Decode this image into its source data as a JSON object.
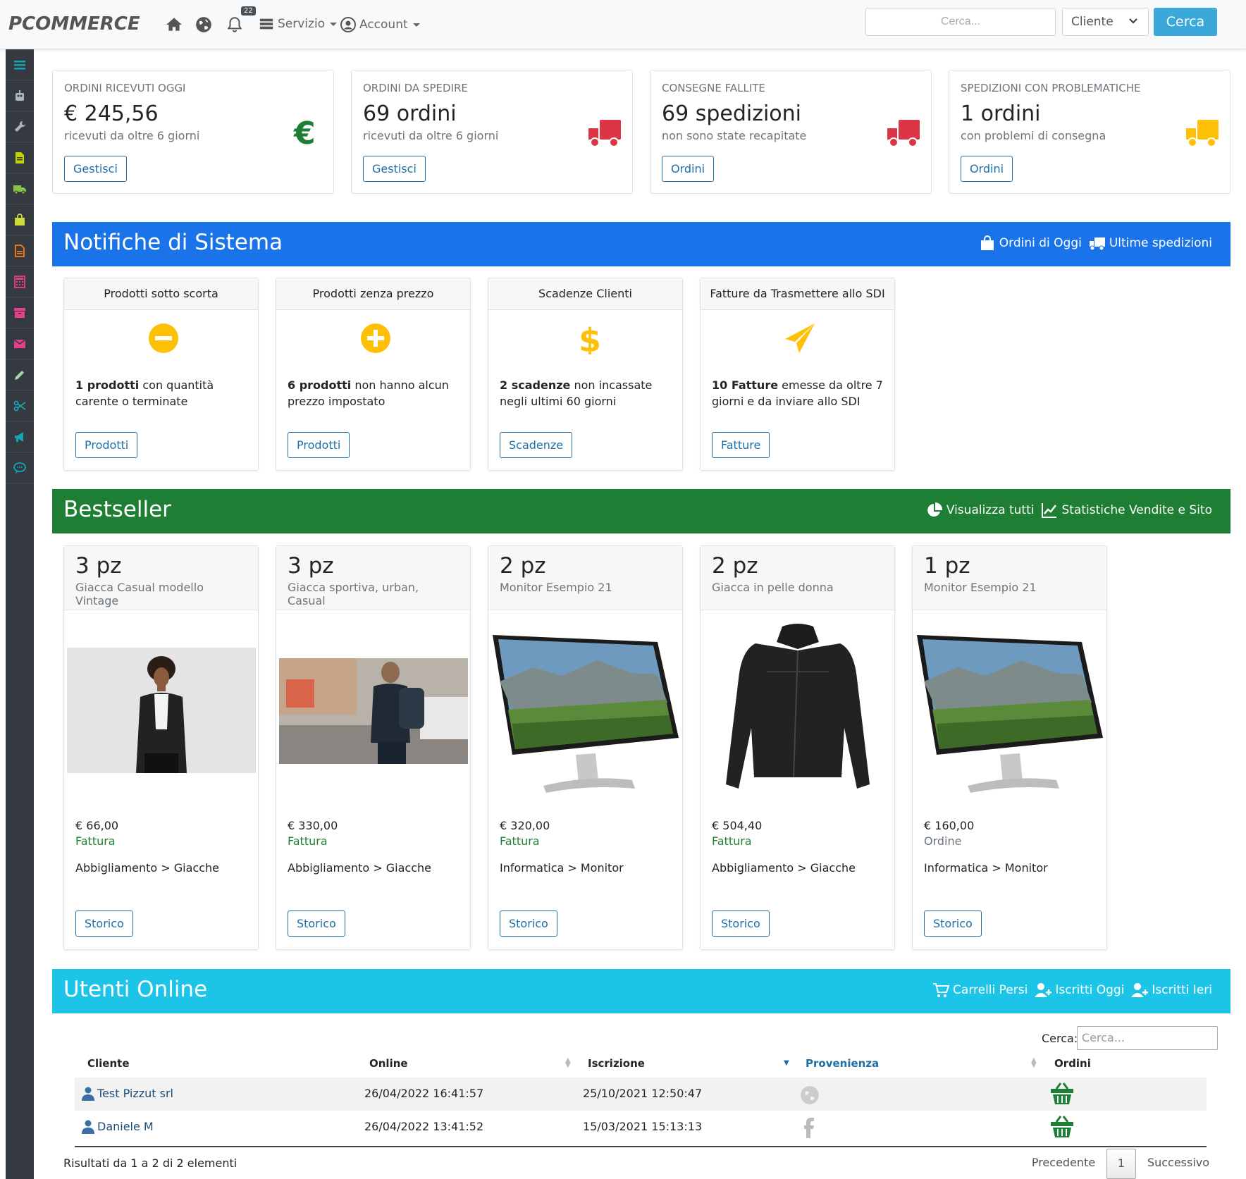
{
  "navbar": {
    "brand": "PCOMMERCE",
    "notification_count": "22",
    "servizio_label": "Servizio",
    "account_label": "Account",
    "search_placeholder": "Cerca...",
    "select_value": "Cliente",
    "search_button": "Cerca"
  },
  "sidebar": {
    "items": [
      "menu-icon",
      "robot-icon",
      "wrench-icon",
      "document-icon",
      "truck-icon",
      "shopping-bag-icon",
      "file-icon",
      "calculator-icon",
      "archive-icon",
      "envelope-icon",
      "pencil-icon",
      "scissors-icon",
      "megaphone-icon",
      "chat-icon"
    ],
    "colors": {
      "menu": "#17a2b8",
      "robot": "#adb5bd",
      "wrench": "#adb5bd",
      "document": "#c5d400",
      "truck": "#8bc34a",
      "bag": "#cddc39",
      "file": "#fd7e14",
      "calculator": "#e83e8c",
      "archive": "#e83e8c",
      "envelope": "#e83e8c",
      "pencil": "#a5d6a7",
      "scissors": "#17a2b8",
      "megaphone": "#17a2b8",
      "chat": "#17a2b8"
    }
  },
  "stats": [
    {
      "label": "ORDINI RICEVUTI OGGI",
      "value": "€ 245,56",
      "sub": "ricevuti da oltre 6 giorni",
      "button": "Gestisci",
      "icon": "euro-icon",
      "color": "#1e7e34"
    },
    {
      "label": "ORDINI DA SPEDIRE",
      "value": "69 ordini",
      "sub": "ricevuti da oltre 6 giorni",
      "button": "Gestisci",
      "icon": "truck-icon",
      "color": "#dc3545"
    },
    {
      "label": "CONSEGNE FALLITE",
      "value": "69 spedizioni",
      "sub": "non sono state recapitate",
      "button": "Ordini",
      "icon": "truck-icon",
      "color": "#dc3545"
    },
    {
      "label": "SPEDIZIONI CON PROBLEMATICHE",
      "value": "1 ordini",
      "sub": "con problemi di consegna",
      "button": "Ordini",
      "icon": "truck-icon",
      "color": "#ffc107"
    }
  ],
  "notifiche": {
    "title": "Notifiche di Sistema",
    "link1": "Ordini di Oggi",
    "link2": "Ultime spedizioni",
    "color": "#1a73e8",
    "cards": [
      {
        "header": "Prodotti sotto scorta",
        "bold": "1 prodotti",
        "text": " con quantità carente o terminate",
        "button": "Prodotti",
        "icon": "minus-circle-icon"
      },
      {
        "header": "Prodotti zenza prezzo",
        "bold": "6 prodotti",
        "text": " non hanno alcun prezzo impostato",
        "button": "Prodotti",
        "icon": "plus-circle-icon"
      },
      {
        "header": "Scadenze Clienti",
        "bold": "2 scadenze",
        "text": " non incassate negli ultimi 60 giorni",
        "button": "Scadenze",
        "icon": "dollar-icon"
      },
      {
        "header": "Fatture da Trasmettere allo SDI",
        "bold": "10 Fatture",
        "text": " emesse da oltre 7 giorni e da inviare allo SDI",
        "button": "Fatture",
        "icon": "paper-plane-icon"
      }
    ]
  },
  "bestseller": {
    "title": "Bestseller",
    "link1": "Visualizza tutti",
    "link2": "Statistiche Vendite e Sito",
    "color": "#1e7e34",
    "products": [
      {
        "qty": "3 pz",
        "name": "Giacca Casual modello Vintage",
        "price": "€ 66,00",
        "doc": "Fattura",
        "category": "Abbigliamento > Giacche",
        "button": "Storico",
        "image": "woman-jacket"
      },
      {
        "qty": "3 pz",
        "name": "Giacca sportiva, urban, Casual",
        "price": "€ 330,00",
        "doc": "Fattura",
        "category": "Abbigliamento > Giacche",
        "button": "Storico",
        "image": "man-street"
      },
      {
        "qty": "2 pz",
        "name": "Monitor Esempio 21",
        "price": "€ 320,00",
        "doc": "Fattura",
        "category": "Informatica > Monitor",
        "button": "Storico",
        "image": "monitor"
      },
      {
        "qty": "2 pz",
        "name": "Giacca in pelle donna",
        "price": "€ 504,40",
        "doc": "Fattura",
        "category": "Abbigliamento > Giacche",
        "button": "Storico",
        "image": "leather-jacket"
      },
      {
        "qty": "1 pz",
        "name": "Monitor Esempio 21",
        "price": "€ 160,00",
        "doc": "Ordine",
        "category": "Informatica > Monitor",
        "button": "Storico",
        "image": "monitor"
      }
    ]
  },
  "utenti": {
    "title": "Utenti Online",
    "link1": "Carrelli Persi",
    "link2": "Iscritti Oggi",
    "link3": "Iscritti Ieri",
    "color": "#1cc4e8",
    "search_label": "Cerca:",
    "search_placeholder": "Cerca...",
    "columns": [
      "Cliente",
      "Online",
      "Iscrizione",
      "Provenienza",
      "Ordini"
    ],
    "rows": [
      {
        "cliente": "Test Pizzut srl",
        "online": "26/04/2022 16:41:57",
        "iscrizione": "25/10/2021 12:50:47",
        "provenienza": "globe-icon"
      },
      {
        "cliente": "Daniele M",
        "online": "26/04/2022 13:41:52",
        "iscrizione": "15/03/2021 15:13:13",
        "provenienza": "facebook-icon"
      }
    ],
    "result_text": "Risultati da 1 a 2 di 2 elementi",
    "prev": "Precedente",
    "page": "1",
    "next": "Successivo"
  }
}
